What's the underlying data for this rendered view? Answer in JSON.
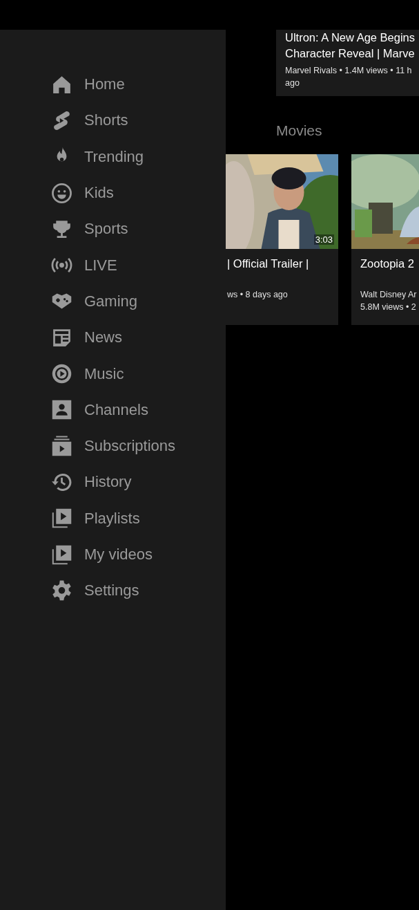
{
  "sidebar": {
    "items": [
      {
        "label": "Home"
      },
      {
        "label": "Shorts"
      },
      {
        "label": "Trending"
      },
      {
        "label": "Kids"
      },
      {
        "label": "Sports"
      },
      {
        "label": "LIVE"
      },
      {
        "label": "Gaming"
      },
      {
        "label": "News"
      },
      {
        "label": "Music"
      },
      {
        "label": "Channels"
      },
      {
        "label": "Subscriptions"
      },
      {
        "label": "History"
      },
      {
        "label": "Playlists"
      },
      {
        "label": "My videos"
      },
      {
        "label": "Settings"
      }
    ]
  },
  "top_video": {
    "title_lines": [
      "Ultron: A New Age Begins",
      "Character Reveal | Marve"
    ],
    "meta_lines": [
      "Marvel Rivals • 1.4M views • 11 h",
      "ago"
    ]
  },
  "movies": {
    "heading": "Movies",
    "videos": [
      {
        "kind": "picture",
        "duration": "3:03",
        "title": "| Official Trailer |",
        "meta_lines": [
          "ws • 8 days ago"
        ]
      },
      {
        "kind": "picture",
        "title": "Zootopia 2",
        "meta_lines": [
          "Walt Disney Ar",
          "5.8M views • 2"
        ]
      }
    ]
  }
}
